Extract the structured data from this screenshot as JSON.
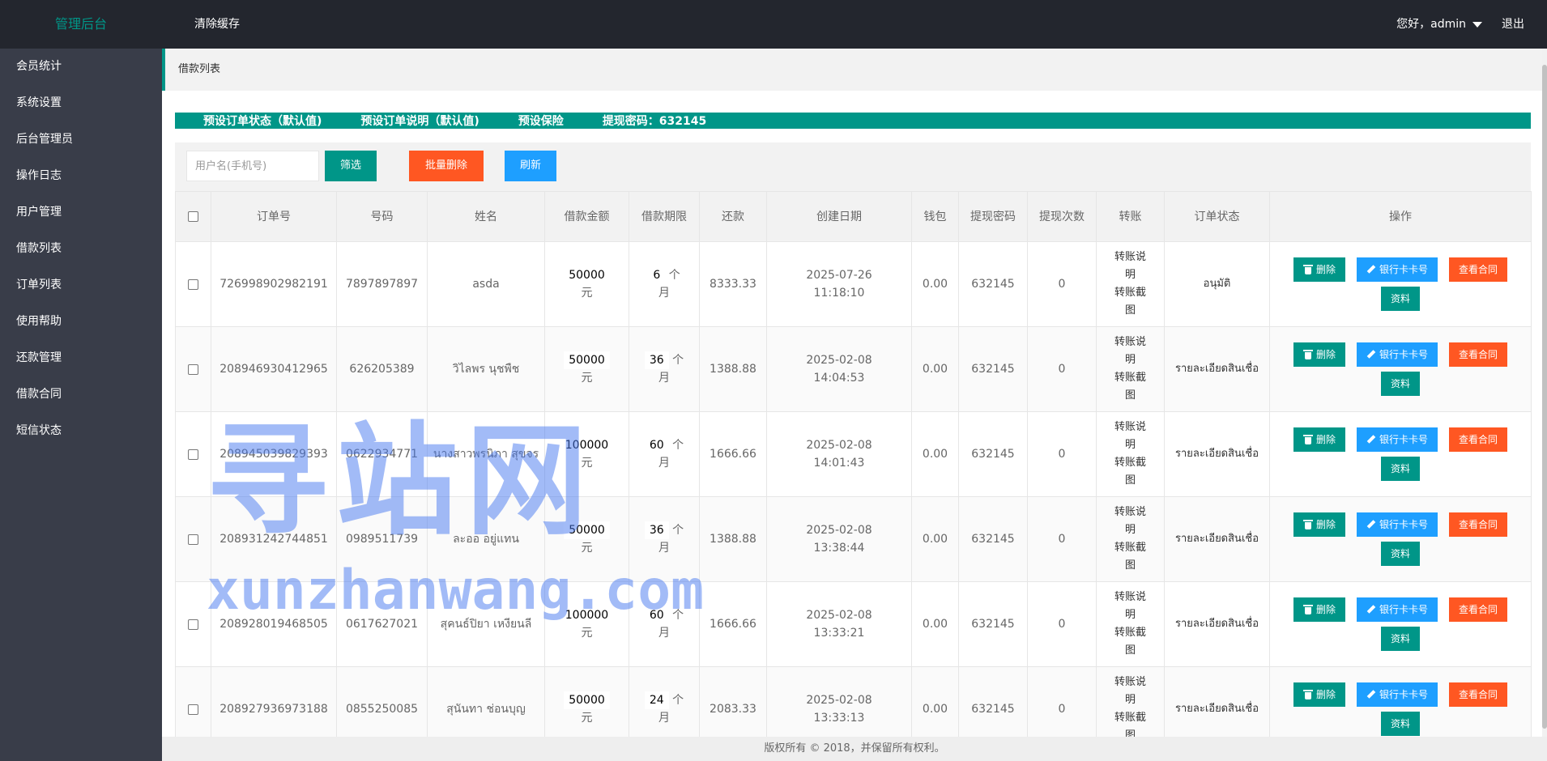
{
  "header": {
    "logo": "管理后台",
    "clear_cache": "清除缓存",
    "greeting": "您好，admin",
    "logout": "退出"
  },
  "sidebar": {
    "items": [
      {
        "label": "会员统计"
      },
      {
        "label": "系统设置"
      },
      {
        "label": "后台管理员"
      },
      {
        "label": "操作日志"
      },
      {
        "label": "用户管理"
      },
      {
        "label": "借款列表"
      },
      {
        "label": "订单列表"
      },
      {
        "label": "使用帮助"
      },
      {
        "label": "还款管理"
      },
      {
        "label": "借款合同"
      },
      {
        "label": "短信状态"
      }
    ]
  },
  "breadcrumb": "借款列表",
  "settings_bar": {
    "item1": "预设订单状态（默认值)",
    "item2": "预设订单说明（默认值)",
    "item3": "预设保险",
    "item4": "提现密码：632145"
  },
  "toolbar": {
    "search_placeholder": "用户名(手机号)",
    "filter_label": "筛选",
    "batch_delete_label": "批量删除",
    "refresh_label": "刷新"
  },
  "table": {
    "headers": {
      "order_no": "订单号",
      "phone": "号码",
      "name": "姓名",
      "amount": "借款金额",
      "term": "借款期限",
      "repay": "还款",
      "created": "创建日期",
      "wallet": "钱包",
      "withdraw_pwd": "提现密码",
      "withdraw_count": "提现次数",
      "transfer": "转账",
      "order_status": "订单状态",
      "actions": "操作"
    },
    "amount_unit": "元",
    "term_unit_a": "个",
    "term_unit_b": "月",
    "transfer_line1": "转账说明",
    "transfer_line2": "转账截图",
    "actions": {
      "delete": "删除",
      "bank_card": "银行卡卡号",
      "contract": "查看合同",
      "info": "资料"
    },
    "rows": [
      {
        "order_no": "726998902982191",
        "phone": "7897897897",
        "name": "asda",
        "amount": "50000",
        "term": "6",
        "repay": "8333.33",
        "date": "2025-07-26",
        "time": "11:18:10",
        "wallet": "0.00",
        "withdraw_pwd": "632145",
        "withdraw_count": "0",
        "status": "อนุมัติ"
      },
      {
        "order_no": "208946930412965",
        "phone": "626205389",
        "name": "วิไลพร นุชพืช",
        "amount": "50000",
        "term": "36",
        "repay": "1388.88",
        "date": "2025-02-08",
        "time": "14:04:53",
        "wallet": "0.00",
        "withdraw_pwd": "632145",
        "withdraw_count": "0",
        "status": "รายละเอียดสินเชื่อ"
      },
      {
        "order_no": "208945039829393",
        "phone": "0622934771",
        "name": "นางสาวพรนิภา สุขจร",
        "amount": "100000",
        "term": "60",
        "repay": "1666.66",
        "date": "2025-02-08",
        "time": "14:01:43",
        "wallet": "0.00",
        "withdraw_pwd": "632145",
        "withdraw_count": "0",
        "status": "รายละเอียดสินเชื่อ"
      },
      {
        "order_no": "208931242744851",
        "phone": "0989511739",
        "name": "ละออ อยู่แทน",
        "amount": "50000",
        "term": "36",
        "repay": "1388.88",
        "date": "2025-02-08",
        "time": "13:38:44",
        "wallet": "0.00",
        "withdraw_pwd": "632145",
        "withdraw_count": "0",
        "status": "รายละเอียดสินเชื่อ"
      },
      {
        "order_no": "208928019468505",
        "phone": "0617627021",
        "name": "สุคนธ์ปิยา เหงียนลี",
        "amount": "100000",
        "term": "60",
        "repay": "1666.66",
        "date": "2025-02-08",
        "time": "13:33:21",
        "wallet": "0.00",
        "withdraw_pwd": "632145",
        "withdraw_count": "0",
        "status": "รายละเอียดสินเชื่อ"
      },
      {
        "order_no": "208927936973188",
        "phone": "0855250085",
        "name": "สุนันทา ช่อนบุญ",
        "amount": "50000",
        "term": "24",
        "repay": "2083.33",
        "date": "2025-02-08",
        "time": "13:33:13",
        "wallet": "0.00",
        "withdraw_pwd": "632145",
        "withdraw_count": "0",
        "status": "รายละเอียดสินเชื่อ"
      }
    ]
  },
  "footer": "版权所有 © 2018，并保留所有权利。",
  "watermark": {
    "main": "寻站网",
    "sub": "xunzhanwang.com"
  },
  "colors": {
    "header_bg": "#23262e",
    "sidebar_bg": "#393d49",
    "accent_green": "#009688",
    "orange": "#ff5722",
    "blue": "#1e9fff"
  }
}
